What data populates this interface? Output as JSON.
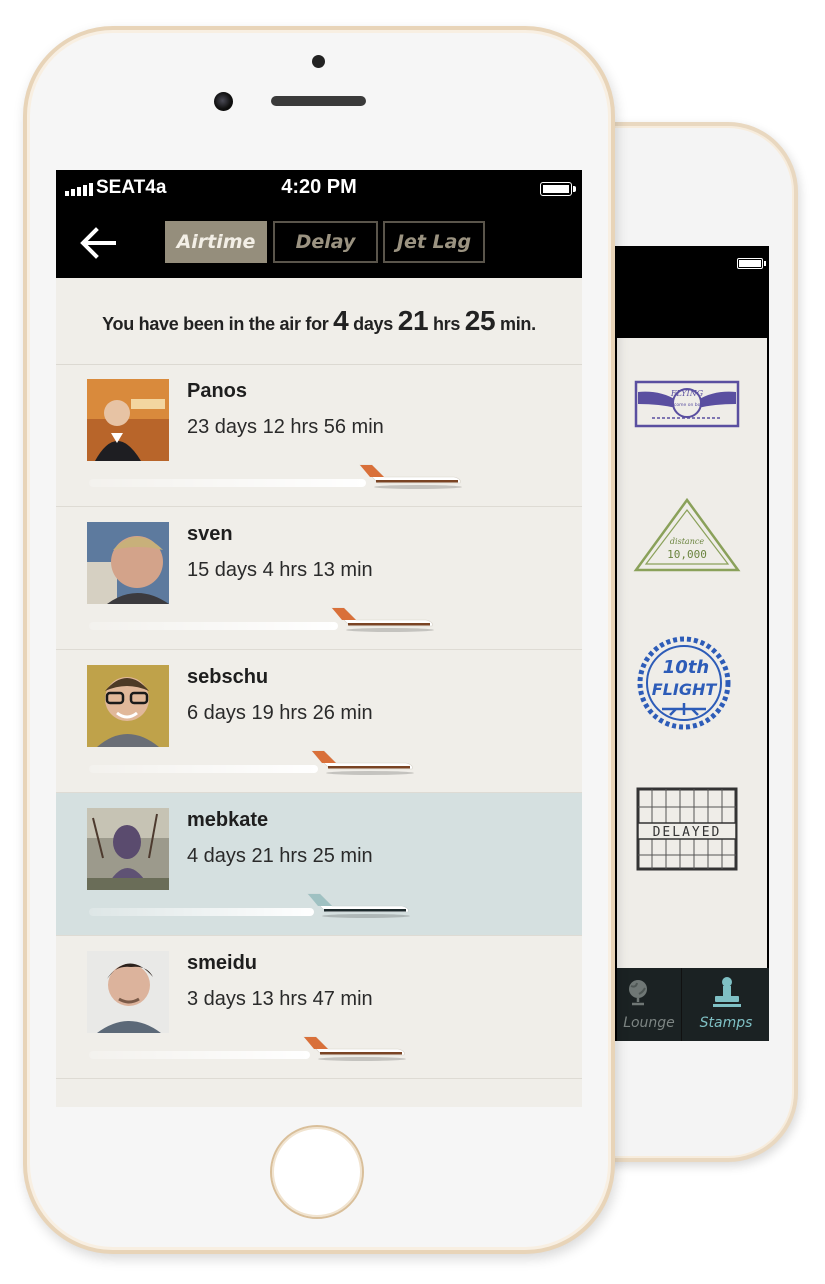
{
  "colors": {
    "accent_plane": "#d9703a",
    "highlight_plane": "#9fc1c2",
    "highlight_row": "#d5e0e0",
    "segment_active": "#958e7c",
    "stamps_tab": "#7fc0c4"
  },
  "statusbar": {
    "carrier": "SEAT4a",
    "time": "4:20 PM"
  },
  "nav": {
    "back_icon": "arrow-left-icon",
    "tabs": [
      {
        "label": "Airtime",
        "active": true
      },
      {
        "label": "Delay",
        "active": false
      },
      {
        "label": "Jet Lag",
        "active": false
      }
    ]
  },
  "summary": {
    "prefix": "You have been in the air for",
    "days": "4",
    "days_unit": "days",
    "hrs": "21",
    "hrs_unit": "hrs",
    "min": "25",
    "min_unit": "min."
  },
  "leaderboard": [
    {
      "name": "Panos",
      "duration": "23 days 12 hrs 56 min",
      "progress": 1.0,
      "highlight": false
    },
    {
      "name": "sven",
      "duration": "15 days 4 hrs 13 min",
      "progress": 0.78,
      "highlight": false
    },
    {
      "name": "sebschu",
      "duration": "6 days 19 hrs 26 min",
      "progress": 0.62,
      "highlight": false
    },
    {
      "name": "mebkate",
      "duration": "4 days 21 hrs 25 min",
      "progress": 0.59,
      "highlight": true
    },
    {
      "name": "smeidu",
      "duration": "3 days 13 hrs 47 min",
      "progress": 0.56,
      "highlight": false
    }
  ],
  "back_phone": {
    "stamps": [
      {
        "icon": "flying-stamp-icon",
        "text_top": "FLYING",
        "text_bottom": "welcome on board"
      },
      {
        "icon": "distance-stamp-icon",
        "text_top": "distance",
        "text_bottom": "10,000"
      },
      {
        "icon": "tenth-flight-stamp-icon",
        "text_top": "10th",
        "text_bottom": "FLIGHT"
      },
      {
        "icon": "delayed-stamp-icon",
        "text_top": "DELAYED"
      }
    ],
    "tabs": [
      {
        "label": "Lounge",
        "icon": "globe-icon",
        "active": false
      },
      {
        "label": "Stamps",
        "icon": "stamp-icon",
        "active": true
      }
    ]
  }
}
